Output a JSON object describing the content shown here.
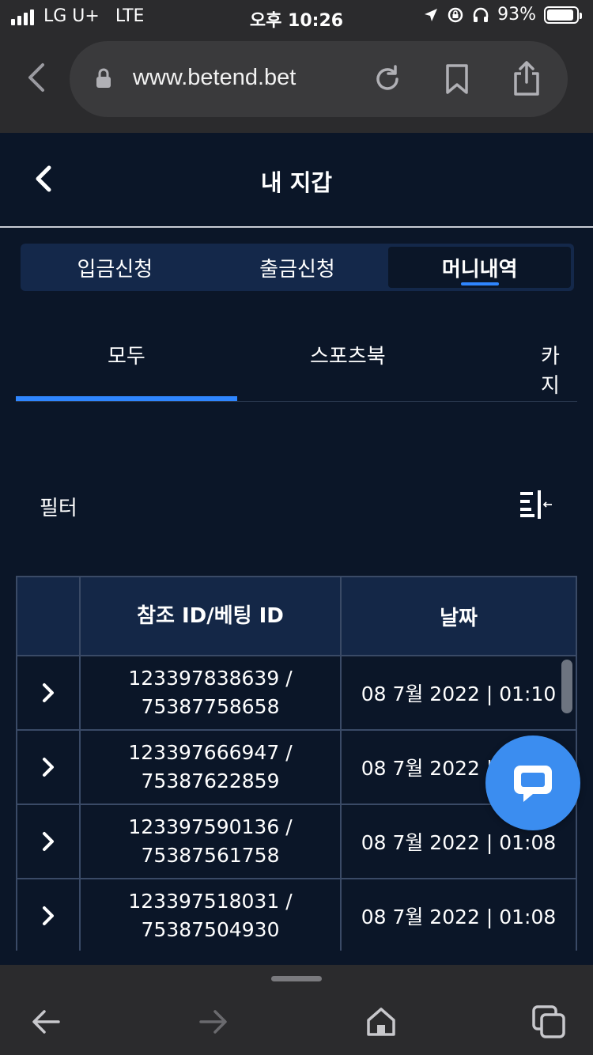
{
  "status_bar": {
    "carrier": "LG U+",
    "network": "LTE",
    "time": "오후 10:26",
    "battery_text": "93%",
    "battery_level": 0.93
  },
  "browser": {
    "url": "www.betend.bet"
  },
  "header": {
    "title": "내 지갑"
  },
  "wallet_tabs": [
    {
      "label": "입금신청",
      "active": false
    },
    {
      "label": "출금신청",
      "active": false
    },
    {
      "label": "머니내역",
      "active": true
    }
  ],
  "category_tabs": [
    {
      "label": "모두",
      "active": true
    },
    {
      "label": "스포츠북",
      "active": false
    },
    {
      "label": "카지",
      "active": false
    }
  ],
  "filter": {
    "label": "필터"
  },
  "table": {
    "headers": {
      "expand": "",
      "ref_id": "참조 ID/베팅 ID",
      "date": "날짜"
    },
    "rows": [
      {
        "ref_id": "123397838639 /",
        "bet_id": "75387758658",
        "date": "08 7월 2022 | 01:10"
      },
      {
        "ref_id": "123397666947 /",
        "bet_id": "75387622859",
        "date": "08 7월 2022 | 01:09"
      },
      {
        "ref_id": "123397590136 /",
        "bet_id": "75387561758",
        "date": "08 7월 2022 | 01:08"
      },
      {
        "ref_id": "123397518031 /",
        "bet_id": "75387504930",
        "date": "08 7월 2022 | 01:08"
      }
    ]
  },
  "colors": {
    "background": "#0b1628",
    "accent": "#2f86ff",
    "chat": "#3b8df0",
    "browser_chrome": "#2b2b2d"
  },
  "icons": [
    "location-icon",
    "lock-rotation-icon",
    "headphones-icon",
    "lock-icon",
    "reload-icon",
    "bookmark-icon",
    "share-icon",
    "back-arrow-icon",
    "filter-icon",
    "chevron-right-icon",
    "chat-icon",
    "forward-arrow-icon",
    "home-icon",
    "tabs-icon"
  ]
}
